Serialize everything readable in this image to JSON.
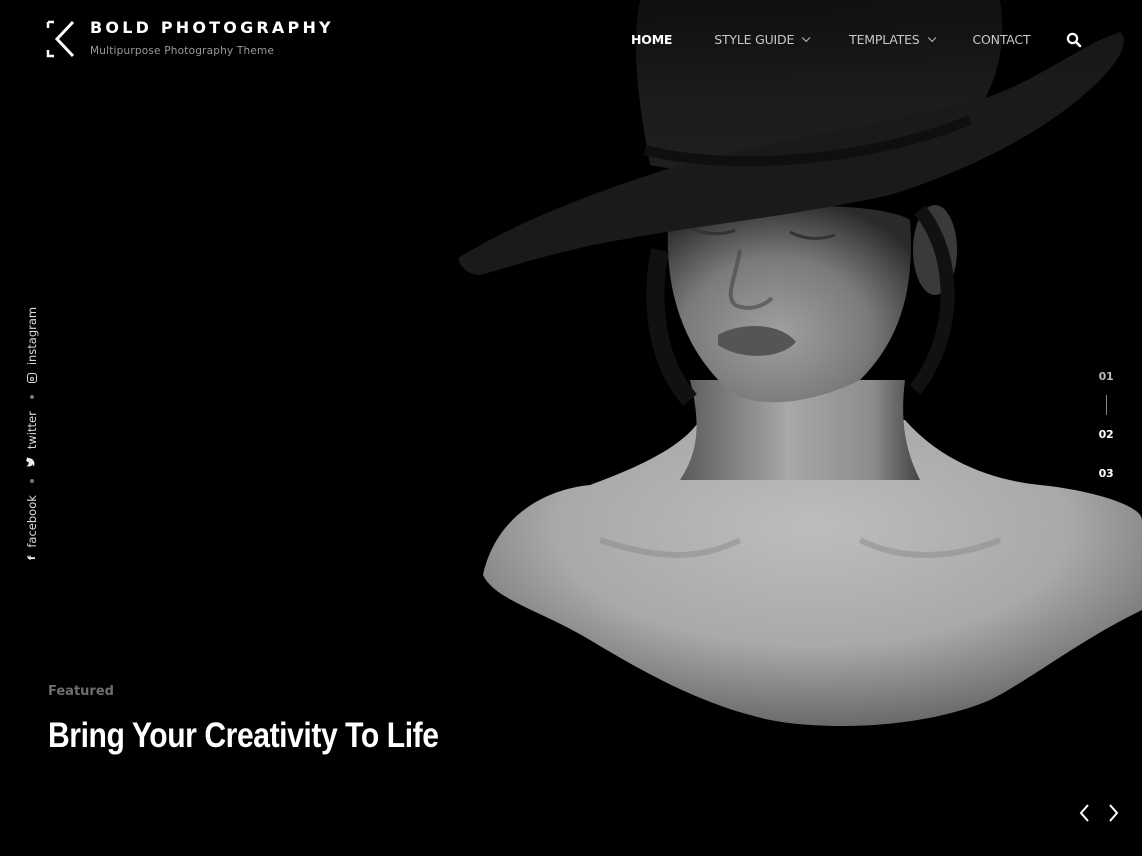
{
  "site": {
    "title": "BOLD PHOTOGRAPHY",
    "tagline": "Multipurpose Photography Theme",
    "logo_icon": "k-monogram-icon"
  },
  "nav": {
    "items": [
      {
        "label": "HOME",
        "active": true,
        "has_dropdown": false
      },
      {
        "label": "STYLE GUIDE",
        "active": false,
        "has_dropdown": true
      },
      {
        "label": "TEMPLATES",
        "active": false,
        "has_dropdown": true
      },
      {
        "label": "CONTACT",
        "active": false,
        "has_dropdown": false
      }
    ],
    "search_icon": "search-icon"
  },
  "social": {
    "links": [
      {
        "label": "facebook",
        "icon": "facebook-icon"
      },
      {
        "label": "twitter",
        "icon": "twitter-icon"
      },
      {
        "label": "instagram",
        "icon": "instagram-icon"
      }
    ]
  },
  "slider": {
    "pages": [
      "01",
      "02",
      "03"
    ],
    "current_index": 0,
    "prev_icon": "chevron-left-icon",
    "next_icon": "chevron-right-icon"
  },
  "caption": {
    "category": "Featured",
    "title": "Bring Your Creativity To Life"
  },
  "colors": {
    "background": "#000000",
    "text": "#ffffff",
    "muted": "#6e6e6e",
    "nav_inactive": "#c8c8c8"
  }
}
